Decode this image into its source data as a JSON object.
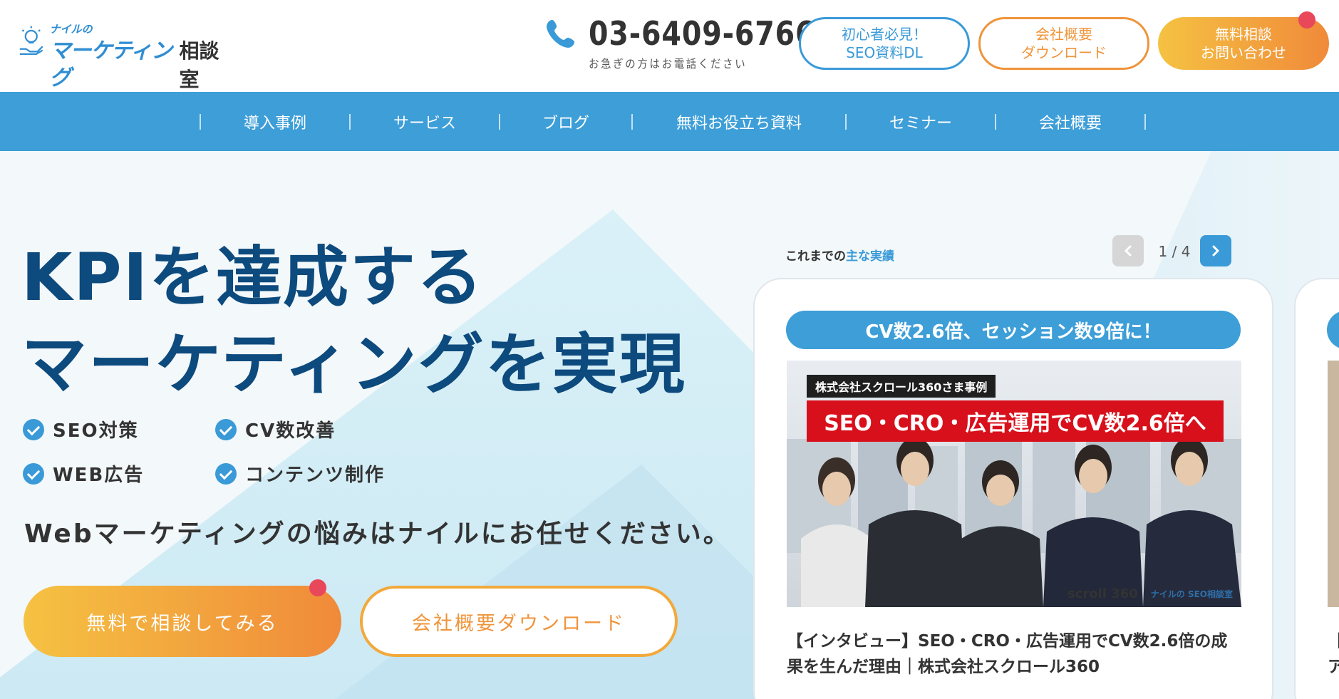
{
  "header": {
    "logo_small": "ナイルの",
    "logo_main": "マーケティング",
    "logo_room": "相談室",
    "phone_number": "03-6409-6766",
    "phone_note": "お急ぎの方はお電話ください",
    "btn_seo_line1": "初心者必見！",
    "btn_seo_line2": "SEO資料DL",
    "btn_dl_line1": "会社概要",
    "btn_dl_line2": "ダウンロード",
    "btn_contact_line1": "無料相談",
    "btn_contact_line2": "お問い合わせ"
  },
  "nav": {
    "items": [
      {
        "label": "導入事例"
      },
      {
        "label": "サービス"
      },
      {
        "label": "ブログ"
      },
      {
        "label": "無料お役立ち資料"
      },
      {
        "label": "セミナー"
      },
      {
        "label": "会社概要"
      }
    ]
  },
  "hero": {
    "headline_1": "KPIを達成する",
    "headline_2": "マーケティングを実現",
    "features": [
      {
        "label": "SEO対策"
      },
      {
        "label": "CV数改善"
      },
      {
        "label": "WEB広告"
      },
      {
        "label": "コンテンツ制作"
      }
    ],
    "subcopy": "Webマーケティングの悩みはナイルにお任せください。",
    "cta_consult": "無料で相談してみる",
    "cta_download": "会社概要ダウンロード"
  },
  "achievements": {
    "label_prefix": "これまでの",
    "label_highlight": "主な実績",
    "pager": "1 / 4",
    "card": {
      "badge": "CV数2.6倍、セッション数9倍に！",
      "image_tag": "株式会社スクロール360さま事例",
      "image_title": "SEO・CRO・広告運用でCV数2.6倍へ",
      "image_logo_1": "scroll 360",
      "image_logo_2": "ナイルの SEO相談室",
      "title": "【インタビュー】SEO・CRO・広告運用でCV数2.6倍の成果を生んだ理由｜株式会社スクロール360"
    },
    "next_card_text_1": "【",
    "next_card_text_2": "ア"
  },
  "colors": {
    "brand_blue": "#3d9ed8",
    "headline_navy": "#0d4a7d",
    "orange": "#f0943a",
    "yellow": "#f5c242",
    "notification_red": "#e8485a",
    "image_red": "#d8101b"
  }
}
